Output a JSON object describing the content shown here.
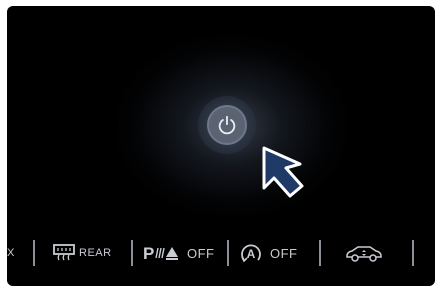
{
  "controls": {
    "power_button": {
      "icon": "power-icon"
    },
    "cursor": {
      "icon": "cursor-arrow-icon",
      "color": "#1f3a66"
    }
  },
  "bottom_bar": {
    "partial_label": "X",
    "rear_defrost": {
      "icon": "rear-defrost-icon",
      "label": "REAR"
    },
    "park_assist": {
      "icon": "park-assist-icon",
      "label": "OFF"
    },
    "auto_stop": {
      "icon": "auto-start-stop-icon",
      "label": "OFF"
    },
    "suspension": {
      "icon": "car-height-icon"
    }
  },
  "colors": {
    "background": "#000000",
    "text": "#c9ccd2",
    "separator": "#8a8f98"
  }
}
